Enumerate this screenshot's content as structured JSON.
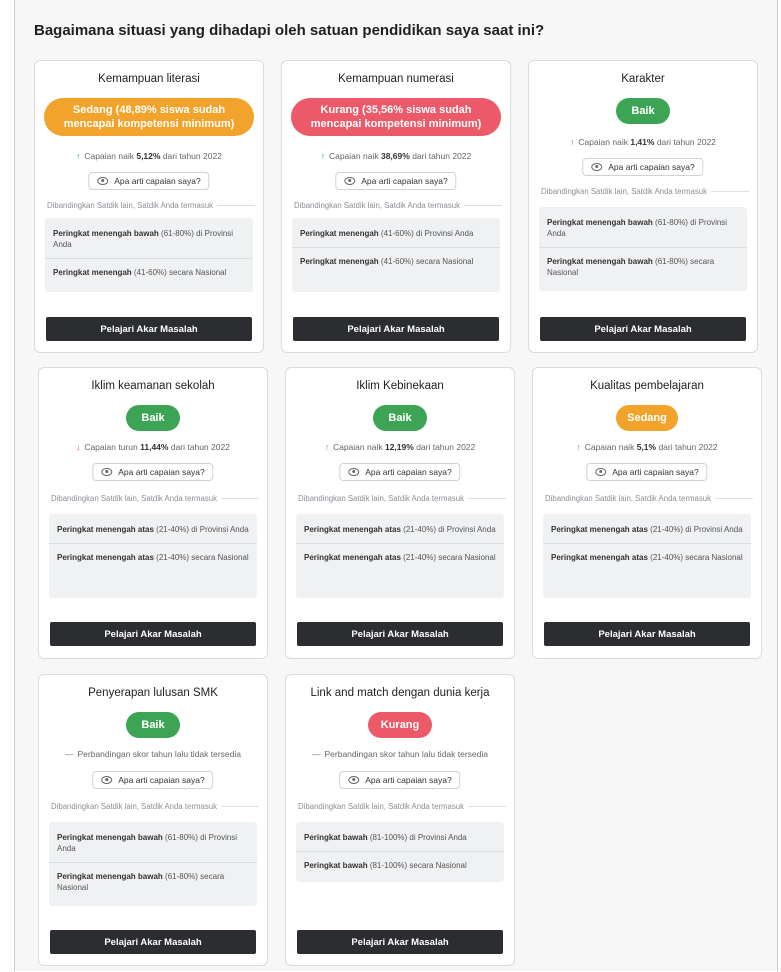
{
  "page": {
    "title": "Bagaimana situasi yang dihadapi oleh satuan pendidikan saya saat ini?"
  },
  "common": {
    "help_label": "Apa arti capaian saya?",
    "compare_label": "Dibandingkan Satdik lain, Satdik Anda termasuk",
    "cta_label": "Pelajari Akar Masalah"
  },
  "colors": {
    "sedang": "#f2a32b",
    "kurang": "#ec5a69",
    "baik": "#3ea455",
    "cta": "#2b2d30"
  },
  "cards": [
    {
      "title": "Kemampuan literasi",
      "status": "Sedang (48,89% siswa sudah mencapai kompetensi minimum)",
      "trend_direction": "up",
      "trend_prefix": "Capaian naik",
      "trend_value": "5,12%",
      "trend_suffix": "dari tahun 2022",
      "rank_1_bold": "Peringkat menengah bawah",
      "rank_1_rest": "(61-80%) di Provinsi Anda",
      "rank_2_bold": "Peringkat menengah",
      "rank_2_rest": "(41-60%) secara Nasional"
    },
    {
      "title": "Kemampuan numerasi",
      "status": "Kurang (35,56% siswa sudah mencapai kompetensi minimum)",
      "trend_direction": "up",
      "trend_prefix": "Capaian naik",
      "trend_value": "38,69%",
      "trend_suffix": "dari tahun 2022",
      "rank_1_bold": "Peringkat menengah",
      "rank_1_rest": "(41-60%) di Provinsi Anda",
      "rank_2_bold": "Peringkat menengah",
      "rank_2_rest": "(41-60%) secara Nasional"
    },
    {
      "title": "Karakter",
      "status": "Baik",
      "trend_direction": "up",
      "trend_prefix": "Capaian naik",
      "trend_value": "1,41%",
      "trend_suffix": "dari tahun 2022",
      "rank_1_bold": "Peringkat menengah bawah",
      "rank_1_rest": "(61-80%) di Provinsi Anda",
      "rank_2_bold": "Peringkat menengah bawah",
      "rank_2_rest": "(61-80%) secara Nasional"
    },
    {
      "title": "Iklim keamanan sekolah",
      "status": "Baik",
      "trend_direction": "down",
      "trend_prefix": "Capaian turun",
      "trend_value": "11,44%",
      "trend_suffix": "dari tahun 2022",
      "rank_1_bold": "Peringkat menengah atas",
      "rank_1_rest": "(21-40%) di Provinsi Anda",
      "rank_2_bold": "Peringkat menengah atas",
      "rank_2_rest": "(21-40%) secara Nasional"
    },
    {
      "title": "Iklim Kebinekaan",
      "status": "Baik",
      "trend_direction": "up",
      "trend_prefix": "Capaian naik",
      "trend_value": "12,19%",
      "trend_suffix": "dari tahun 2022",
      "rank_1_bold": "Peringkat menengah atas",
      "rank_1_rest": "(21-40%) di Provinsi Anda",
      "rank_2_bold": "Peringkat menengah atas",
      "rank_2_rest": "(21-40%) secara Nasional"
    },
    {
      "title": "Kualitas pembelajaran",
      "status": "Sedang",
      "trend_direction": "up",
      "trend_prefix": "Capaian naik",
      "trend_value": "5,1%",
      "trend_suffix": "dari tahun 2022",
      "rank_1_bold": "Peringkat menengah atas",
      "rank_1_rest": "(21-40%) di Provinsi Anda",
      "rank_2_bold": "Peringkat menengah atas",
      "rank_2_rest": "(21-40%) secara Nasional"
    },
    {
      "title": "Penyerapan lulusan SMK",
      "status": "Baik",
      "trend_direction": "none",
      "trend_text": "Perbandingan skor tahun lalu tidak tersedia",
      "rank_1_bold": "Peringkat menengah bawah",
      "rank_1_rest": "(61-80%) di Provinsi Anda",
      "rank_2_bold": "Peringkat menengah bawah",
      "rank_2_rest": "(61-80%) secara Nasional"
    },
    {
      "title": "Link and match dengan dunia kerja",
      "status": "Kurang",
      "trend_direction": "none",
      "trend_text": "Perbandingan skor tahun lalu tidak tersedia",
      "rank_1_bold": "Peringkat bawah",
      "rank_1_rest": "(81-100%) di Provinsi Anda",
      "rank_2_bold": "Peringkat bawah",
      "rank_2_rest": "(81-100%) secara Nasional"
    }
  ]
}
